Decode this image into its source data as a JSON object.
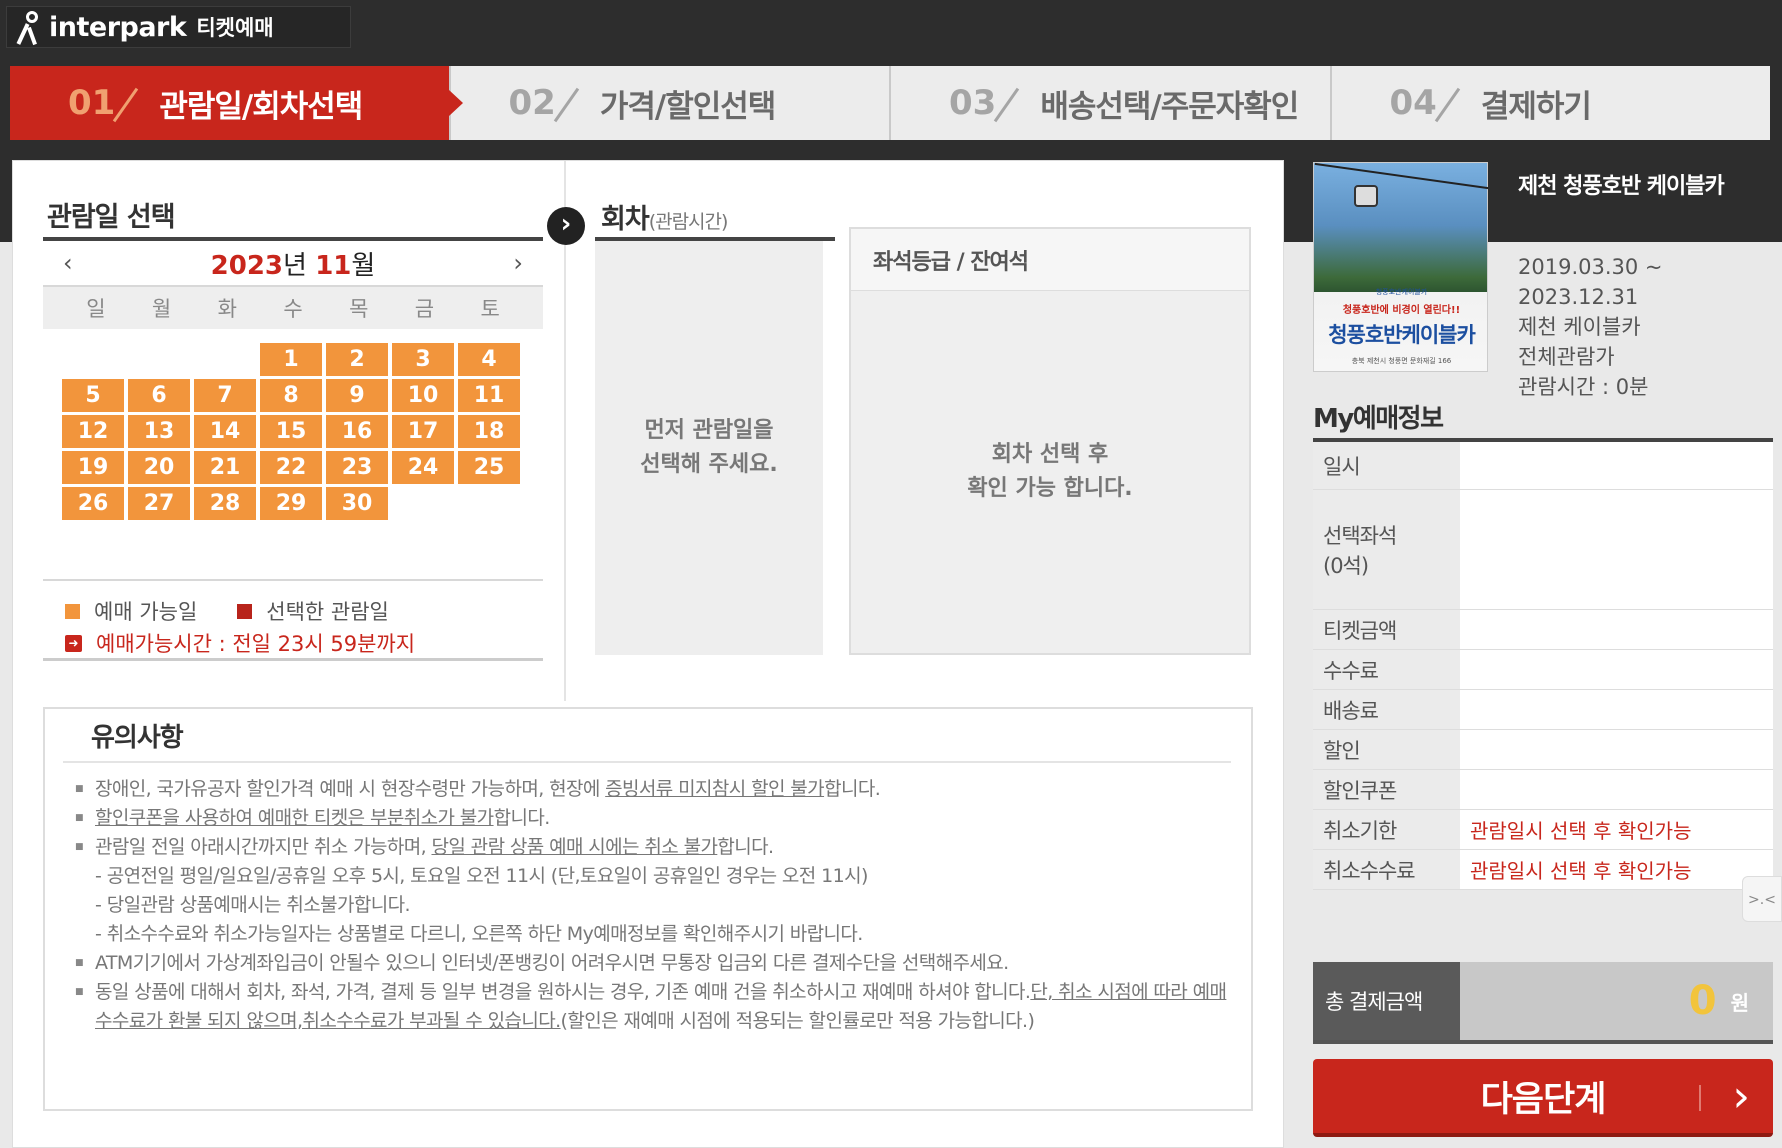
{
  "header": {
    "logo_text": "interpark",
    "logo_sub": "티켓예매"
  },
  "steps": [
    {
      "num": "01",
      "label": "관람일/회차선택",
      "active": true
    },
    {
      "num": "02",
      "label": "가격/할인선택",
      "active": false
    },
    {
      "num": "03",
      "label": "배송선택/주문자확인",
      "active": false
    },
    {
      "num": "04",
      "label": "결제하기",
      "active": false
    }
  ],
  "date_section": {
    "title": "관람일 선택",
    "prev": "‹",
    "next": "›",
    "year": "2023",
    "year_suffix": "년 ",
    "month": "11",
    "month_suffix": "월",
    "weekdays": [
      "일",
      "월",
      "화",
      "수",
      "목",
      "금",
      "토"
    ],
    "weeks": [
      [
        "",
        "",
        "",
        "1",
        "2",
        "3",
        "4"
      ],
      [
        "5",
        "6",
        "7",
        "8",
        "9",
        "10",
        "11"
      ],
      [
        "12",
        "13",
        "14",
        "15",
        "16",
        "17",
        "18"
      ],
      [
        "19",
        "20",
        "21",
        "22",
        "23",
        "24",
        "25"
      ],
      [
        "26",
        "27",
        "28",
        "29",
        "30",
        "",
        ""
      ]
    ],
    "legend_available": "예매 가능일",
    "legend_selected": "선택한 관람일",
    "booking_time": "예매가능시간 : 전일 23시 59분까지"
  },
  "round_section": {
    "title": "회차",
    "subtitle": "(관람시간)",
    "message_line1": "먼저 관람일을",
    "message_line2": "선택해 주세요."
  },
  "seat_section": {
    "title": "좌석등급 / 잔여석",
    "message_line1": "회차 선택 후",
    "message_line2": "확인 가능 합니다."
  },
  "notice": {
    "title": "유의사항",
    "items": [
      {
        "pre": "장애인, 국가유공자 할인가격 예매 시 현장수령만 가능하며, 현장에 ",
        "u": "증빙서류 미지참시 할인 불가",
        "post": "합니다."
      },
      {
        "pre": "",
        "u": "할인쿠폰을 사용하여 예매한 티켓은 부분취소가 불가",
        "post": "합니다."
      },
      {
        "pre": "관람일 전일 아래시간까지만 취소 가능하며, ",
        "u": "당일 관람 상품 예매 시에는 취소 불가",
        "post": "합니다."
      }
    ],
    "sub_items": [
      "- 공연전일 평일/일요일/공휴일 오후 5시, 토요일 오전 11시 (단,토요일이 공휴일인 경우는 오전 11시)",
      "- 당일관람 상품예매시는 취소불가합니다.",
      "- 취소수수료와 취소가능일자는 상품별로 다르니, 오른쪽 하단 My예매정보를 확인해주시기 바랍니다."
    ],
    "atm": "ATM기기에서 가상계좌입금이 안될수 있으니 인터넷/폰뱅킹이 어려우시면 무통장 입금외 다른 결제수단을 선택해주세요.",
    "change_pre": "동일 상품에 대해서 회차, 좌석, 가격, 결제 등 일부 변경을 원하시는 경우, 기존 예매 건을 취소하시고 재예매 하셔야 합니다.",
    "change_u1": "단, 취소 시점에 따라 예매수수료가 환불 되지 않으며,",
    "change_u2": "취소수수료가 부과될 수 있습니다.",
    "change_post": "(할인은 재예매 시점에 적용되는 할인률로만 적용 가능합니다.)"
  },
  "product": {
    "title": "제천 청풍호반 케이블카",
    "date_start": "2019.03.30 ~",
    "date_end": "2023.12.31",
    "venue": "제천 케이블카",
    "rating": "전체관람가",
    "duration": "관람시간 : 0분",
    "poster_line0": "청풍호반케이블카",
    "poster_line1": "청풍호반에 비경이 열린다!!",
    "poster_line2": "청풍호반케이블카",
    "poster_line3": "충북 제천시 청풍면 문화재길 166"
  },
  "my_booking": {
    "title": "My예매정보",
    "rows": [
      {
        "key": "일시",
        "value": ""
      },
      {
        "key": "선택좌석\n(0석)",
        "value": ""
      },
      {
        "key": "티켓금액",
        "value": ""
      },
      {
        "key": "수수료",
        "value": ""
      },
      {
        "key": "배송료",
        "value": ""
      },
      {
        "key": "할인",
        "value": ""
      },
      {
        "key": "할인쿠폰",
        "value": ""
      },
      {
        "key": "취소기한",
        "value": "관람일시 선택 후 확인가능"
      },
      {
        "key": "취소수수료",
        "value": "관람일시 선택 후 확인가능"
      }
    ],
    "total_label": "총 결제금액",
    "total_amount": "0",
    "total_unit": "원",
    "next_button": "다음단계",
    "float_label": ">.<"
  },
  "colors": {
    "accent_red": "#c8261c",
    "available_orange": "#f2953c",
    "header_dark": "#2d2d2d"
  }
}
